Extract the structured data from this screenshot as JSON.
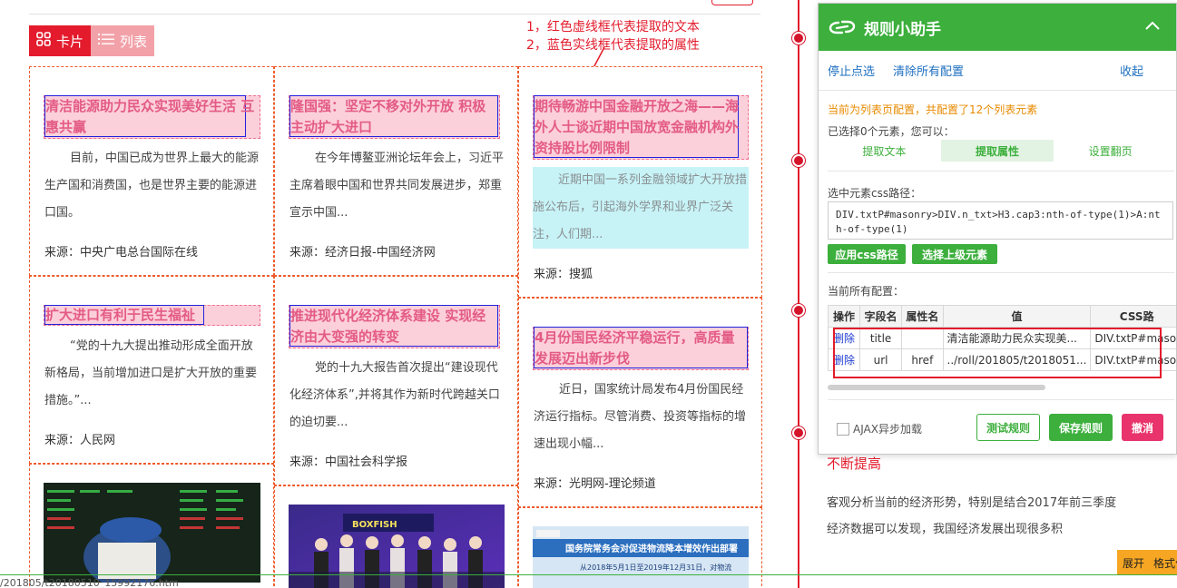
{
  "view_toggle": {
    "card": "卡片",
    "list": "列表"
  },
  "annotation": {
    "line1": "1，红色虚线框代表提取的文本",
    "line2": "2，蓝色实线框代表提取的属性"
  },
  "cards": [
    {
      "title": "清洁能源助力民众实现美好生活 互惠共赢",
      "summary": "目前，中国已成为世界上最大的能源生产国和消费国，也是世界主要的能源进口国。",
      "source": "来源：中央广电总台国际在线"
    },
    {
      "title": "扩大进口有利于民生福祉",
      "summary": "“党的十九大提出推动形成全面开放新格局，当前增加进口是扩大开放的重要措施。”...",
      "source": "来源：人民网"
    },
    {
      "title": "隆国强：坚定不移对外开放 积极主动扩大进口",
      "summary": "在今年博鳌亚洲论坛年会上，习近平主席着眼中国和世界共同发展进步，郑重宣示中国...",
      "source": "来源：经济日报-中国经济网"
    },
    {
      "title": "推进现代化经济体系建设 实现经济由大变强的转变",
      "summary": "党的十九大报告首次提出“建设现代化经济体系”,并将其作为新时代跨越关口的迫切要...",
      "source": "来源：中国社会科学报"
    },
    {
      "title": "期待畅游中国金融开放之海——海外人士谈近期中国放宽金融机构外资持股比例限制",
      "summary": "近期中国一系列金融领域扩大开放措施公布后，引起海外学界和业界广泛关注，人们期...",
      "source": "来源：搜狐"
    },
    {
      "title": "4月份国民经济平稳运行，高质量发展迈出新步伐",
      "summary": "近日，国家统计局发布4月份国民经济运行指标。尽管消费、投资等指标的增速出现小幅...",
      "source": "来源：光明网-理论频道"
    }
  ],
  "thumb_texts": {
    "thumb3_banner": "国务院常务会对促进物流降本增效作出部署",
    "thumb3_sub": "从2018年5月1日至2019年12月31日，对物流",
    "thumb2_sign": "BOXFISH"
  },
  "helper": {
    "title": "规则小助手",
    "stop_pick": "停止点选",
    "clear_all": "清除所有配置",
    "collapse": "收起",
    "notice": "当前为列表页配置，共配置了12个列表元素",
    "selected_info": "已选择0个元素，您可以：",
    "tabs": [
      "提取文本",
      "提取属性",
      "设置翻页"
    ],
    "css_label": "选中元素css路径：",
    "css_path": "DIV.txtP#masonry>DIV.n_txt>H3.cap3:nth-of-type(1)>A:nth-of-type(1)",
    "apply_css": "应用css路径",
    "select_parent": "选择上级元素",
    "config_label": "当前所有配置：",
    "table_headers": [
      "操作",
      "字段名",
      "属性名",
      "值",
      "CSS路"
    ],
    "table_rows": [
      [
        "删除",
        "title",
        "",
        "清洁能源助力民众实现美...",
        "DIV.txtP#maso"
      ],
      [
        "删除",
        "url",
        "href",
        "../roll/201805/t2018051...",
        "DIV.txtP#maso"
      ]
    ],
    "ajax": "AJAX异步加载",
    "test_rule": "测试规则",
    "save_rule": "保存规则",
    "cancel": "撤消"
  },
  "article": {
    "title": "不断提高",
    "body": "客观分析当前的经济形势，特别是结合2017年前三季度经济数据可以发现，我国经济发展出现很多积"
  },
  "expand_bar": {
    "expand": "展开",
    "format": "格式化"
  },
  "status_url": "/201805/t20180510_15992176.htm"
}
